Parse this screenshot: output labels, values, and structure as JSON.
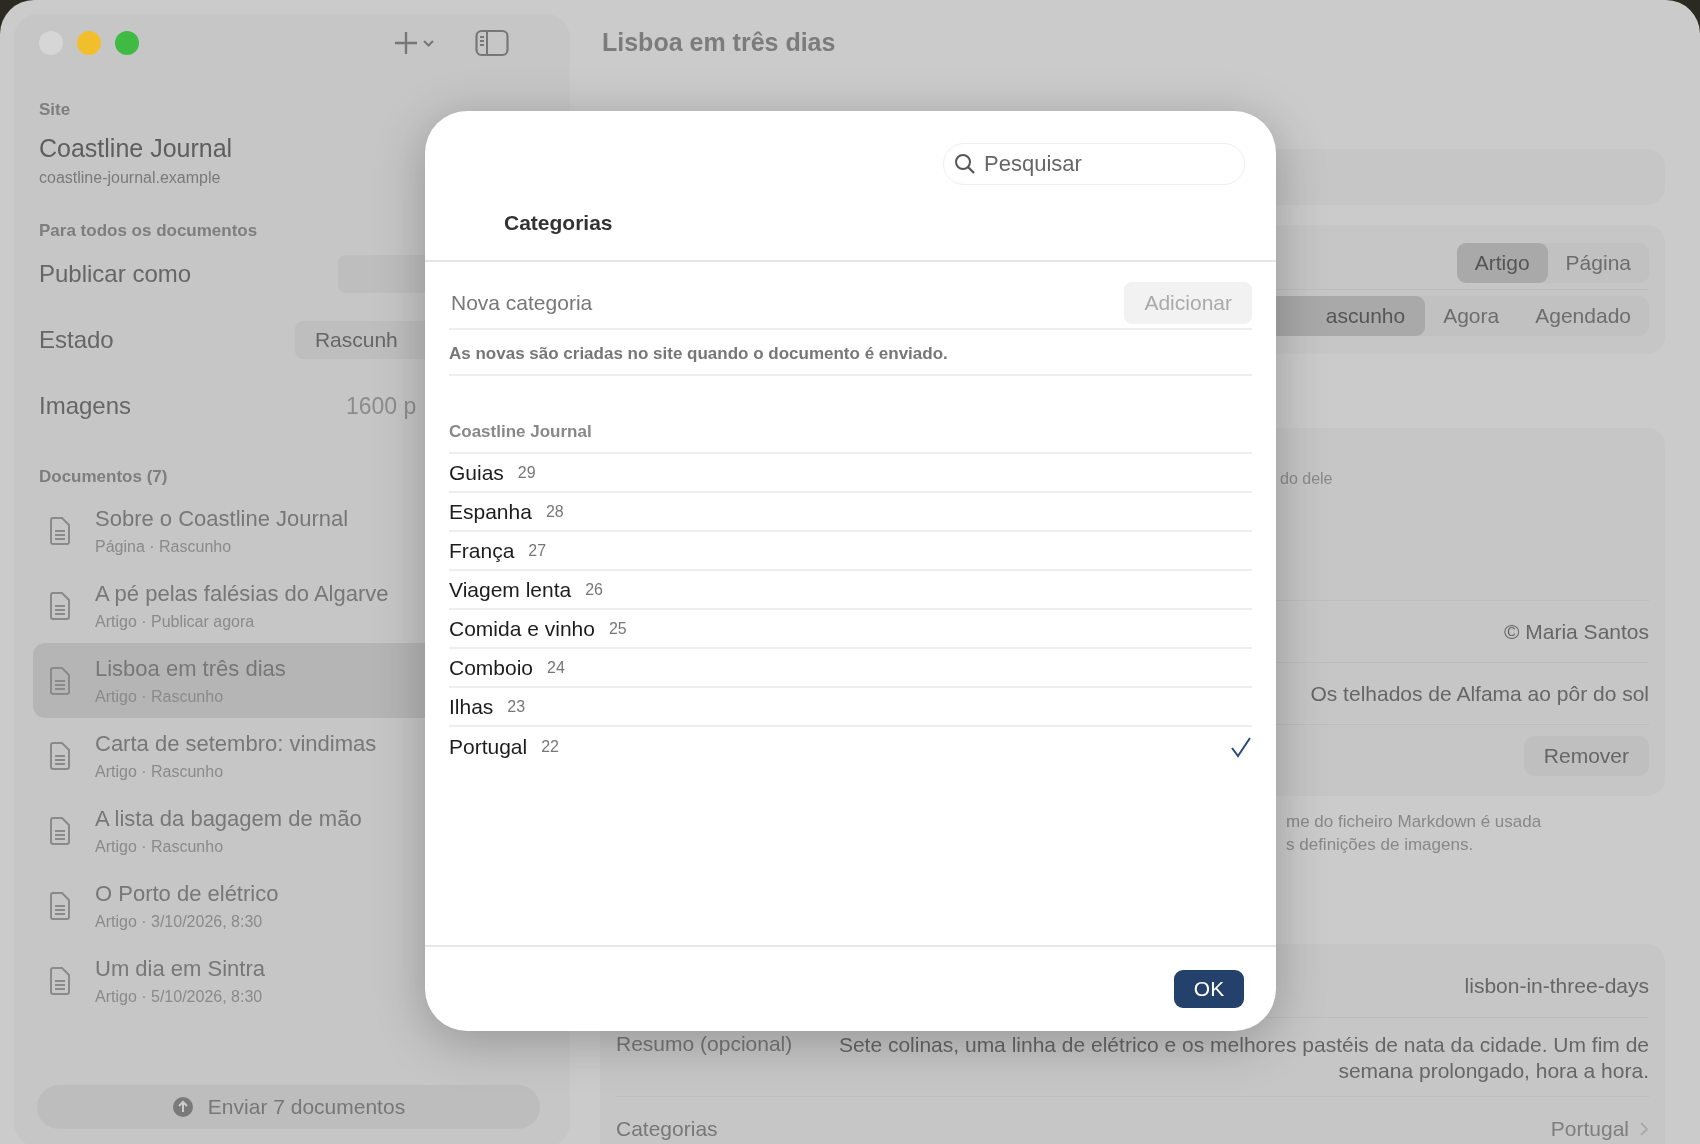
{
  "window": {
    "title": "Lisboa em três dias"
  },
  "sidebar": {
    "site_label": "Site",
    "site_name": "Coastline Journal",
    "site_url": "coastline-journal.example",
    "settings_label": "Para todos os documentos",
    "settings": [
      {
        "label": "Publicar como",
        "kind": "popup"
      },
      {
        "label": "Estado",
        "kind": "popup",
        "value": "Rascunh"
      },
      {
        "label": "Imagens",
        "kind": "text",
        "value": "1600 p"
      }
    ],
    "documents_label": "Documentos (7)",
    "documents": [
      {
        "title": "Sobre o Coastline Journal",
        "subtitle": "Página · Rascunho",
        "selected": false
      },
      {
        "title": "A pé pelas falésias do Algarve",
        "subtitle": "Artigo · Publicar agora",
        "selected": false
      },
      {
        "title": "Lisboa em três dias",
        "subtitle": "Artigo · Rascunho",
        "selected": true
      },
      {
        "title": "Carta de setembro: vindimas",
        "subtitle": "Artigo · Rascunho",
        "selected": false
      },
      {
        "title": "A lista da bagagem de mão",
        "subtitle": "Artigo · Rascunho",
        "selected": false
      },
      {
        "title": "O Porto de elétrico",
        "subtitle": "Artigo · 3/10/2026, 8:30",
        "selected": false
      },
      {
        "title": "Um dia em Sintra",
        "subtitle": "Artigo · 5/10/2026, 8:30",
        "selected": false
      }
    ],
    "send_button": "Enviar 7 documentos"
  },
  "editor": {
    "type_options": [
      {
        "label": "Artigo",
        "selected": true
      },
      {
        "label": "Página",
        "selected": false
      }
    ],
    "publish_options": [
      {
        "label": "ascunho",
        "selected": true
      },
      {
        "label": "Agora",
        "selected": false
      },
      {
        "label": "Agendado",
        "selected": false
      }
    ],
    "image_note": "do dele",
    "image_credit": "© Maria Santos",
    "image_caption": "Os telhados de Alfama ao pôr do sol",
    "remove_button": "Remover",
    "footnote": [
      "me do ficheiro Markdown é usada",
      "s definições de imagens."
    ],
    "slug": "lisbon-in-three-days",
    "summary_label": "Resumo (opcional)",
    "summary": "Sete colinas, uma linha de elétrico e os melhores pastéis de nata da cidade. Um fim de semana prolongado, hora a hora.",
    "categories_label": "Categorias",
    "categories_value": "Portugal"
  },
  "dialog": {
    "search": {
      "placeholder": "Pesquisar"
    },
    "title": "Categorias",
    "new_category": {
      "placeholder": "Nova categoria"
    },
    "add_button": {
      "label": "Adicionar",
      "disabled": true
    },
    "hint": "As novas são criadas no site quando o documento é enviado.",
    "group": "Coastline Journal",
    "categories": [
      {
        "name": "Guias",
        "count": "29",
        "selected": false
      },
      {
        "name": "Espanha",
        "count": "28",
        "selected": false
      },
      {
        "name": "França",
        "count": "27",
        "selected": false
      },
      {
        "name": "Viagem lenta",
        "count": "26",
        "selected": false
      },
      {
        "name": "Comida e vinho",
        "count": "25",
        "selected": false
      },
      {
        "name": "Comboio",
        "count": "24",
        "selected": false
      },
      {
        "name": "Ilhas",
        "count": "23",
        "selected": false
      },
      {
        "name": "Portugal",
        "count": "22",
        "selected": true
      }
    ],
    "ok_button": "OK"
  }
}
